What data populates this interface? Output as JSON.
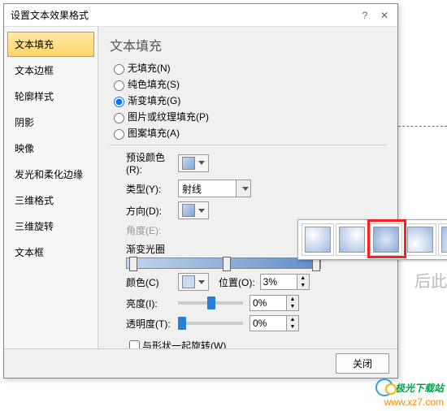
{
  "dialog": {
    "title": "设置文本效果格式"
  },
  "sidebar": {
    "items": [
      {
        "label": "文本填充"
      },
      {
        "label": "文本边框"
      },
      {
        "label": "轮廓样式"
      },
      {
        "label": "阴影"
      },
      {
        "label": "映像"
      },
      {
        "label": "发光和柔化边缘"
      },
      {
        "label": "三维格式"
      },
      {
        "label": "三维旋转"
      },
      {
        "label": "文本框"
      }
    ]
  },
  "fill": {
    "heading": "文本填充",
    "options": {
      "none": "无填充(N)",
      "solid": "纯色填充(S)",
      "gradient": "渐变填充(G)",
      "picture": "图片或纹理填充(P)",
      "pattern": "图案填充(A)"
    },
    "preset_label": "预设颜色(R):",
    "type_label": "类型(Y):",
    "type_value": "射线",
    "direction_label": "方向(D):",
    "angle_label": "角度(E):",
    "stops_label": "渐变光圈",
    "color_label": "颜色(C)",
    "position_label": "位置(O):",
    "position_value": "3%",
    "brightness_label": "亮度(I):",
    "brightness_value": "0%",
    "transparency_label": "透明度(T):",
    "transparency_value": "0%",
    "rotate_with_shape": "与形状一起旋转(W)"
  },
  "footer": {
    "close": "关闭"
  },
  "background": {
    "hint_text": "后此"
  },
  "watermark": {
    "brand": "极光下载站",
    "url": "www.xz7.com"
  }
}
